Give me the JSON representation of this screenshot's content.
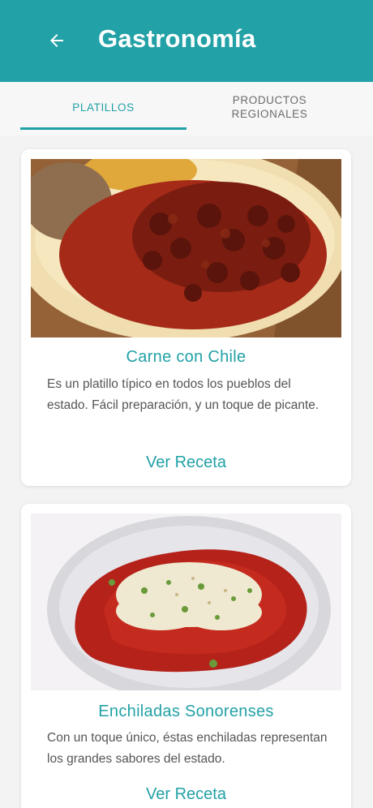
{
  "app_bar": {
    "title": "Gastronomía",
    "back_icon": "arrow-left-icon",
    "color": "#22a1a6"
  },
  "tabs": [
    {
      "label": "PLATILLOS",
      "selected": true
    },
    {
      "label": "PRODUCTOS\nREGIONALES",
      "selected": false
    }
  ],
  "cards": [
    {
      "title": "Carne con Chile",
      "description": "Es un platillo típico en todos los pueblos del estado. Fácil preparación, y un toque de picante.",
      "link": "Ver Receta"
    },
    {
      "title": "Enchiladas Sonorenses",
      "description": "Con un toque único, éstas enchiladas representan los grandes sabores del estado.",
      "link": "Ver Receta"
    }
  ]
}
